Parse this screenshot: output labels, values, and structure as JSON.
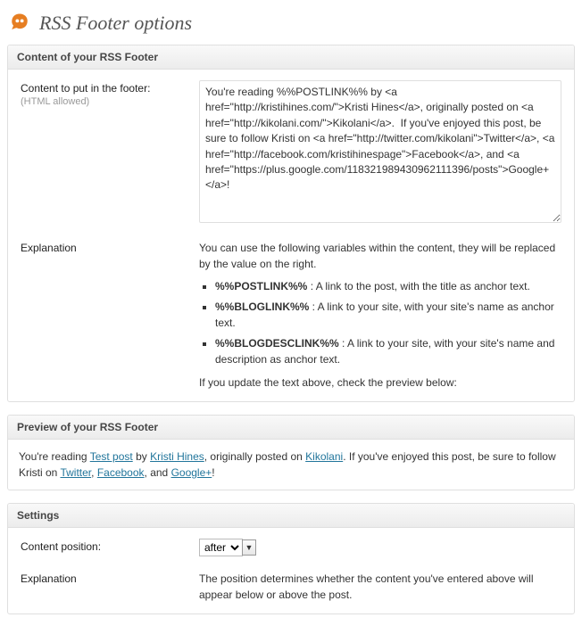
{
  "page": {
    "title": "RSS Footer options"
  },
  "content_section": {
    "title": "Content of your RSS Footer",
    "content_label": "Content to put in the footer:",
    "content_sublabel": "(HTML allowed)",
    "content_value": "You're reading %%POSTLINK%% by <a href=\"http://kristihines.com/\">Kristi Hines</a>, originally posted on <a href=\"http://kikolani.com/\">Kikolani</a>.  If you've enjoyed this post, be sure to follow Kristi on <a href=\"http://twitter.com/kikolani\">Twitter</a>, <a href=\"http://facebook.com/kristihinespage\">Facebook</a>, and <a href=\"https://plus.google.com/118321989430962111396/posts\">Google+</a>!",
    "explanation_label": "Explanation",
    "explanation_intro": "You can use the following variables within the content, they will be replaced by the value on the right.",
    "variables": [
      {
        "name": "%%POSTLINK%%",
        "desc": " : A link to the post, with the title as anchor text."
      },
      {
        "name": "%%BLOGLINK%%",
        "desc": " : A link to your site, with your site's name as anchor text."
      },
      {
        "name": "%%BLOGDESCLINK%%",
        "desc": " : A link to your site, with your site's name and description as anchor text."
      }
    ],
    "explanation_outro": "If you update the text above, check the preview below:"
  },
  "preview_section": {
    "title": "Preview of your RSS Footer",
    "text_parts": {
      "p1": "You're reading ",
      "link1": "Test post",
      "p2": " by ",
      "link2": "Kristi Hines",
      "p3": ", originally posted on ",
      "link3": "Kikolani",
      "p4": ". If you've enjoyed this post, be sure to follow Kristi on ",
      "link4": "Twitter",
      "p5": ", ",
      "link5": "Facebook",
      "p6": ", and ",
      "link6": "Google+",
      "p7": "!"
    }
  },
  "settings_section": {
    "title": "Settings",
    "position_label": "Content position:",
    "position_value": "after",
    "explanation_label": "Explanation",
    "explanation_text": "The position determines whether the content you've entered above will appear below or above the post."
  }
}
